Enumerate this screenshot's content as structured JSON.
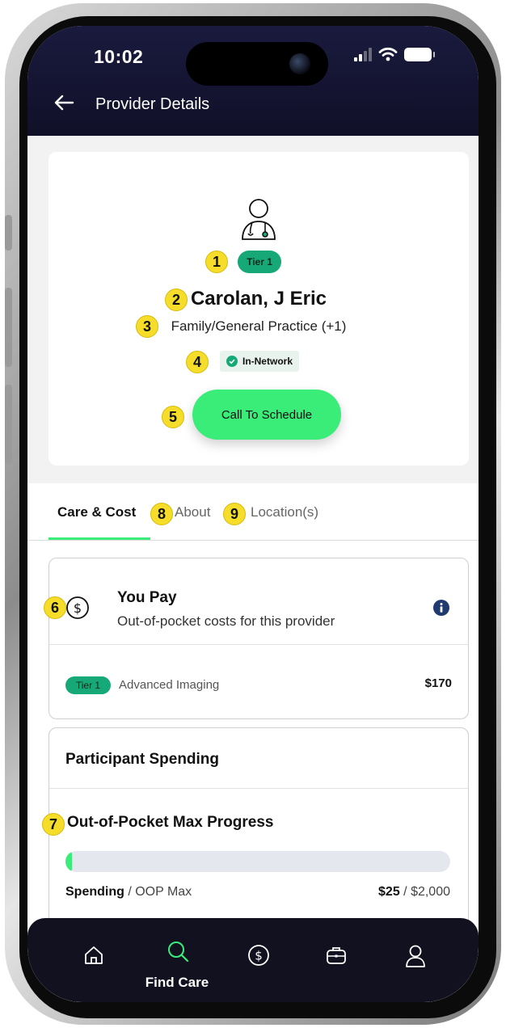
{
  "status_bar": {
    "time": "10:02"
  },
  "header": {
    "title": "Provider Details"
  },
  "provider": {
    "tier": "Tier 1",
    "name": "Carolan, J Eric",
    "specialty": "Family/General Practice (+1)",
    "network_status": "In-Network",
    "call_button": "Call To Schedule"
  },
  "tabs": [
    {
      "label": "Care & Cost",
      "active": true
    },
    {
      "label": "About",
      "active": false
    },
    {
      "label": "Location(s)",
      "active": false
    }
  ],
  "you_pay": {
    "title": "You Pay",
    "subtitle": "Out-of-pocket costs for this provider",
    "rows": [
      {
        "tier": "Tier 1",
        "service": "Advanced Imaging",
        "price": "$170"
      }
    ]
  },
  "spending": {
    "title": "Participant Spending",
    "oop_title": "Out-of-Pocket Max Progress",
    "spending_label": "Spending",
    "max_label": "/ OOP Max",
    "spent": "$25",
    "max": "/ $2,000",
    "progress_fraction": 0.0125
  },
  "annotations": [
    "1",
    "2",
    "3",
    "4",
    "5",
    "6",
    "7",
    "8",
    "9"
  ],
  "bottom_nav": {
    "active_label": "Find Care",
    "items": [
      "home-icon",
      "search-icon",
      "dollar-icon",
      "briefcase-icon",
      "person-icon"
    ]
  },
  "colors": {
    "accent": "#3aec78",
    "tier": "#17a877",
    "header": "#14142f",
    "info": "#1f3a6e"
  }
}
